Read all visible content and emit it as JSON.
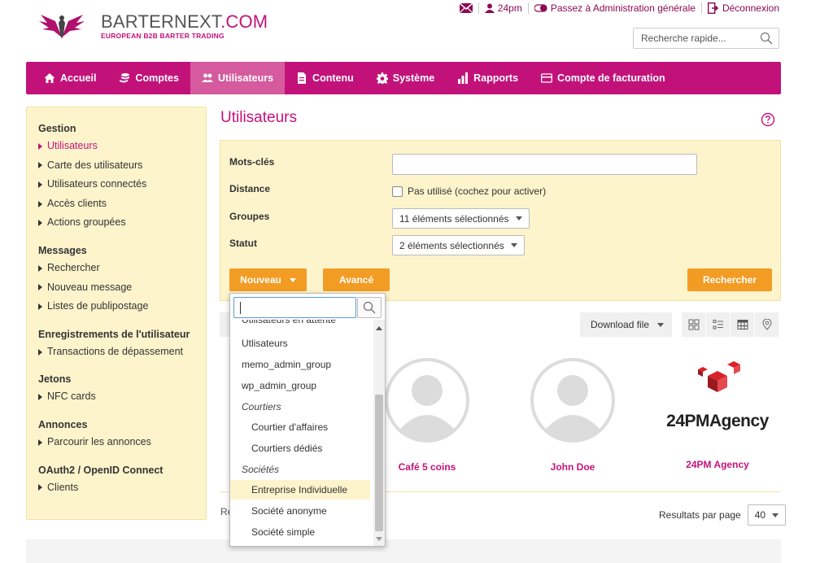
{
  "brand": {
    "name_main": "BARTERNEXT",
    "name_suffix": ".COM",
    "tagline": "EUROPEAN B2B BARTER TRADING"
  },
  "topbar": {
    "messages_icon": "envelope-icon",
    "user_label": "24pm",
    "admin_link": "Passez à Administration générale",
    "logout_link": "Déconnexion"
  },
  "quick_search": {
    "placeholder": "Recherche rapide..."
  },
  "nav": {
    "items": [
      {
        "label": "Accueil",
        "icon": "home-icon"
      },
      {
        "label": "Comptes",
        "icon": "coins-icon"
      },
      {
        "label": "Utilisateurs",
        "icon": "users-icon",
        "active": true
      },
      {
        "label": "Contenu",
        "icon": "document-icon"
      },
      {
        "label": "Système",
        "icon": "gear-icon"
      },
      {
        "label": "Rapports",
        "icon": "bar-chart-icon"
      },
      {
        "label": "Compte de facturation",
        "icon": "credit-card-icon"
      }
    ]
  },
  "sidebar": {
    "sections": [
      {
        "title": "Gestion",
        "links": [
          "Utilisateurs",
          "Carte des utilisateurs",
          "Utilisateurs connectés",
          "Accès clients",
          "Actions groupées"
        ]
      },
      {
        "title": "Messages",
        "links": [
          "Rechercher",
          "Nouveau message",
          "Listes de publipostage"
        ]
      },
      {
        "title": "Enregistrements de l'utilisateur",
        "links": [
          "Transactions de dépassement"
        ]
      },
      {
        "title": "Jetons",
        "links": [
          "NFC cards"
        ]
      },
      {
        "title": "Annonces",
        "links": [
          "Parcourir les annonces"
        ]
      },
      {
        "title": "OAuth2 / OpenID Connect",
        "links": [
          "Clients"
        ]
      }
    ]
  },
  "page": {
    "title": "Utilisateurs"
  },
  "filters": {
    "keywords_label": "Mots-clés",
    "keywords_value": "",
    "distance_label": "Distance",
    "distance_check": "Pas utilisé (cochez pour activer)",
    "groups_label": "Groupes",
    "groups_value": "11 éléments sélectionnés",
    "status_label": "Statut",
    "status_value": "2 éléments sélectionnés",
    "new_button": "Nouveau",
    "advanced_button": "Avancé",
    "search_button": "Rechercher"
  },
  "results": {
    "download_label": "Download file",
    "cards": [
      {
        "name": "Café 5 coins"
      },
      {
        "name": "John Doe"
      },
      {
        "name": "24PM Agency",
        "logo_text": "24PMAgency"
      }
    ],
    "footer_prefix": "Re",
    "per_page_label": "Resultats par page",
    "per_page_value": "40"
  },
  "dropdown": {
    "search_value": "",
    "items": [
      {
        "label": "Utilisateurs en attente",
        "type": "item"
      },
      {
        "label": "Utlisateurs",
        "type": "item"
      },
      {
        "label": "memo_admin_group",
        "type": "item"
      },
      {
        "label": "wp_admin_group",
        "type": "item"
      },
      {
        "label": "Courtiers",
        "type": "group"
      },
      {
        "label": "Courtier d'affaires",
        "type": "child"
      },
      {
        "label": "Courtiers dédiés",
        "type": "child"
      },
      {
        "label": "Sociétés",
        "type": "group"
      },
      {
        "label": "Entreprise Individuelle",
        "type": "child",
        "hover": true
      },
      {
        "label": "Société anonyme",
        "type": "child"
      },
      {
        "label": "Société simple",
        "type": "child"
      }
    ]
  },
  "colors": {
    "brand": "#c2127a",
    "accent_orange": "#f39c24",
    "panel_yellow": "#fdf4cc"
  }
}
